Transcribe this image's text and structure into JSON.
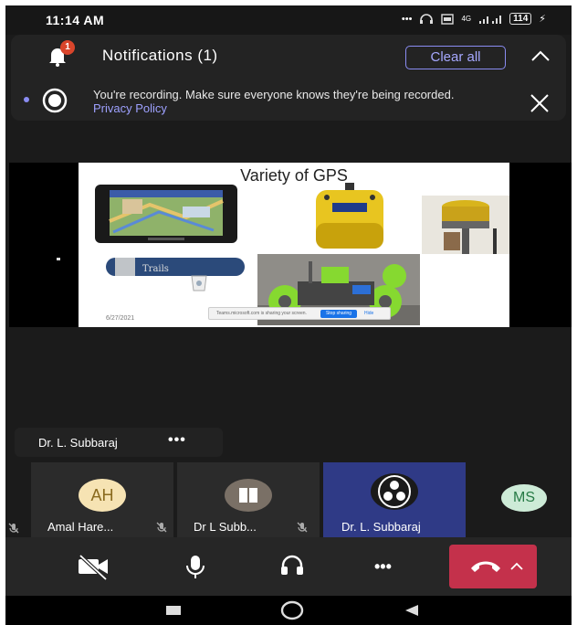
{
  "status_bar": {
    "time": "11:14 AM",
    "network_type": "4G",
    "battery": "114"
  },
  "notifications": {
    "badge_count": "1",
    "title": "Notifications (1)",
    "clear_all": "Clear all",
    "message": "You're recording. Make sure everyone knows they're being recorded.",
    "link_text": "Privacy Policy"
  },
  "slide": {
    "title": "Variety of GPS",
    "date": "6/27/2021",
    "share_notice": "Teams.microsoft.com is sharing your screen.",
    "stop_sharing": "Stop sharing",
    "hide": "Hide"
  },
  "presenter": {
    "name": "Dr. L. Subbaraj",
    "more": "•••"
  },
  "participants": [
    {
      "initials": "AH",
      "name": "Amal Hare...",
      "avatar_color": "#f6e3b3",
      "initials_color": "#8a6a1e",
      "muted": true
    },
    {
      "initials": "",
      "name": "Dr L Subb...",
      "avatar_color": "#7a7066",
      "muted": true
    },
    {
      "initials": "",
      "name": "Dr. L. Subbaraj",
      "avatar_color": "#1a1a1a",
      "muted": false
    },
    {
      "initials": "MS",
      "name": "",
      "avatar_color": "#cdebd7",
      "initials_color": "#267a45",
      "muted": false
    }
  ],
  "controls": {
    "more": "•••",
    "hangup_color": "#c4314b"
  },
  "colors": {
    "accent": "#8a8cf2",
    "link": "#9ea1ff",
    "badge": "#d9452b",
    "background": "#1b1b1b"
  }
}
